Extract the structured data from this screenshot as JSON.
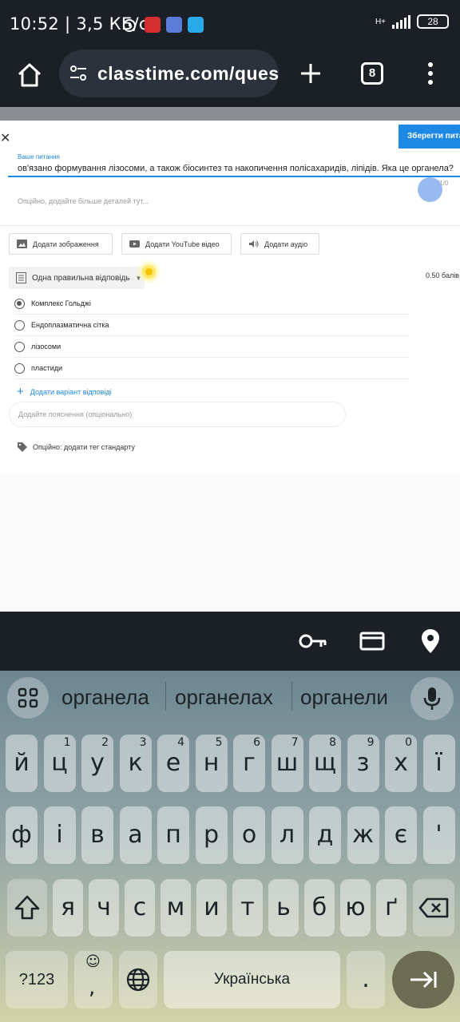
{
  "status_bar": {
    "time": "10:52",
    "speed": "3,5 КБ/с",
    "network": "H+",
    "battery": "28"
  },
  "browser": {
    "url": "classtime.com/quest",
    "tab_count": "8"
  },
  "editor": {
    "save_button": "Зберегти питан",
    "question_label": "Ваше питання",
    "question_text": "ов'язано формування лізосоми, а також біосинтез та накопичення полісахаридів, ліпідів. Яка це органела?",
    "counter": "/1/0",
    "description_placeholder": "Опційно, додайте більше деталей тут...",
    "media_buttons": [
      "Додати зображення",
      "Додати YouTube відео",
      "Додати аудіо"
    ],
    "question_type": "Одна правильна відповідь",
    "points": "0.50 балів",
    "options": [
      {
        "label": "Комплекс Гольджі",
        "selected": true
      },
      {
        "label": "Ендоплазматична сітка",
        "selected": false
      },
      {
        "label": "лізосоми",
        "selected": false
      },
      {
        "label": "пластиди",
        "selected": false
      }
    ],
    "add_option": "Додати варіант відповіді",
    "explanation_placeholder": "Додайте пояснення (опціонально)",
    "tag_label": "Опційно: додати тег стандарту"
  },
  "keyboard": {
    "suggestions": [
      "органела",
      "органелах",
      "органели"
    ],
    "row1": [
      "й",
      "ц",
      "у",
      "к",
      "е",
      "н",
      "г",
      "ш",
      "щ",
      "з",
      "х",
      "ї"
    ],
    "row1_hints": [
      "",
      "1",
      "2",
      "3",
      "4",
      "5",
      "6",
      "7",
      "8",
      "9",
      "0",
      ""
    ],
    "row2": [
      "ф",
      "і",
      "в",
      "а",
      "п",
      "р",
      "о",
      "л",
      "д",
      "ж",
      "є",
      "'"
    ],
    "row3": [
      "я",
      "ч",
      "с",
      "м",
      "и",
      "т",
      "ь",
      "б",
      "ю",
      "ґ"
    ],
    "symbols_key": "?123",
    "emoji_key": "☺",
    "comma_key": ",",
    "space_label": "Українська",
    "period_key": "."
  },
  "colors": {
    "accent": "#1e88e5",
    "dark": "#1b1f26"
  }
}
